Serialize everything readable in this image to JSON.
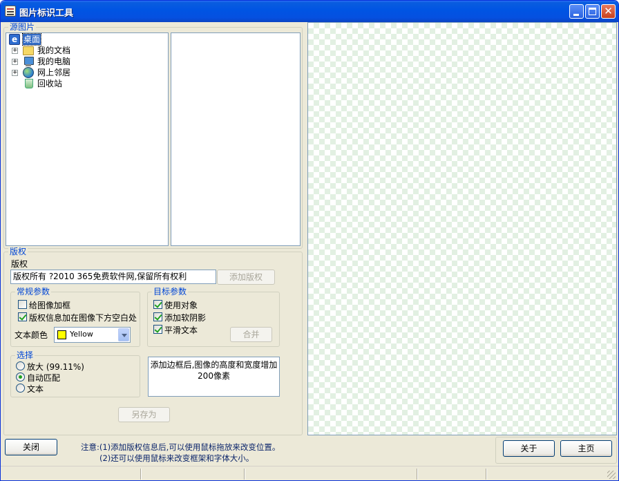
{
  "window": {
    "title": "图片标识工具"
  },
  "source": {
    "legend": "源图片",
    "tree": [
      {
        "label": "桌面",
        "icon": "desktop-icon",
        "selected": true,
        "expandable": false
      },
      {
        "label": "我的文档",
        "icon": "my-documents-icon",
        "expandable": true
      },
      {
        "label": "我的电脑",
        "icon": "my-computer-icon",
        "expandable": true
      },
      {
        "label": "网上邻居",
        "icon": "network-places-icon",
        "expandable": true
      },
      {
        "label": "回收站",
        "icon": "recycle-bin-icon",
        "expandable": false
      }
    ]
  },
  "copyright": {
    "legend": "版权",
    "label": "版权",
    "value": "版权所有 ?2010 365免费软件网,保留所有权利",
    "add_button": "添加版权"
  },
  "general": {
    "legend": "常规参数",
    "add_frame": {
      "label": "给图像加框",
      "checked": false
    },
    "info_below": {
      "label": "版权信息加在图像下方空白处",
      "checked": true
    },
    "text_color_label": "文本颜色",
    "text_color_value": "Yellow",
    "text_color_hex": "#ffff00"
  },
  "target": {
    "legend": "目标参数",
    "use_object": {
      "label": "使用对象",
      "checked": true
    },
    "soft_shadow": {
      "label": "添加软阴影",
      "checked": true
    },
    "smooth_text": {
      "label": "平滑文本",
      "checked": true
    },
    "merge_button": "合并"
  },
  "select": {
    "legend": "选择",
    "options": [
      {
        "label": "放大 (99.11%)",
        "checked": false
      },
      {
        "label": "自动匹配",
        "checked": true
      },
      {
        "label": "文本",
        "checked": false
      }
    ]
  },
  "description": "添加边框后,图像的高度和宽度增加200像素",
  "save_as_button": "另存为",
  "footer": {
    "close_button": "关闭",
    "note_line1": "注意:(1)添加版权信息后,可以使用鼠标拖放来改变位置。",
    "note_line2": "(2)还可以使用鼠标来改变框架和字体大小。",
    "about_button": "关于",
    "home_button": "主页"
  }
}
